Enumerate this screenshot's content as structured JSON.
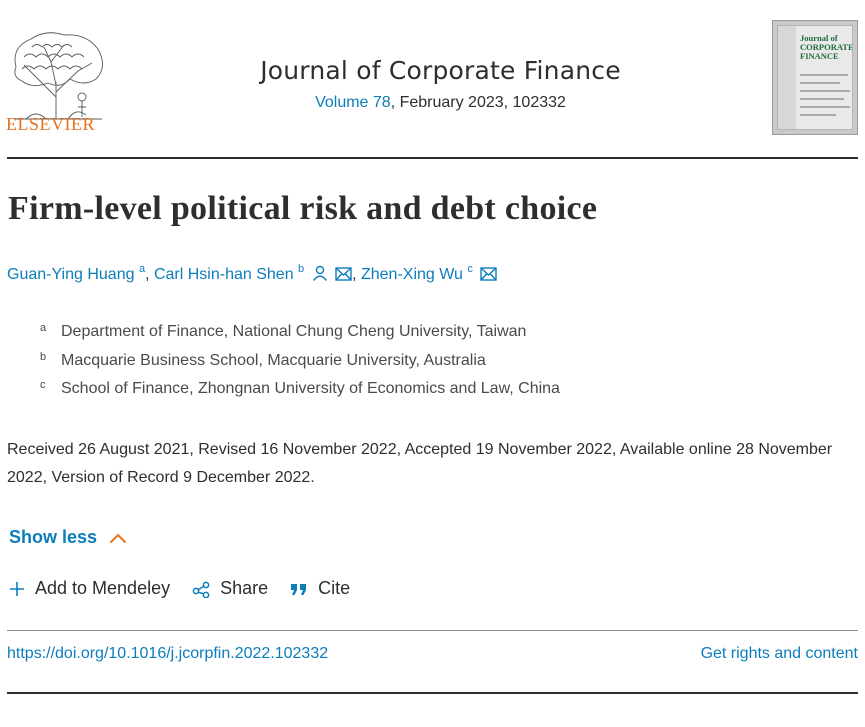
{
  "publisher": {
    "name": "ELSEVIER",
    "brand_color": "#e9711c"
  },
  "journal": {
    "title": "Journal of Corporate Finance",
    "volume_link": "Volume 78",
    "issue_info": ", February 2023, 102332",
    "cover_title": "Journal of CORPORATE FINANCE"
  },
  "article": {
    "title": "Firm-level political risk and debt choice",
    "authors": [
      {
        "name": "Guan-Ying Huang",
        "affil": "a"
      },
      {
        "name": "Carl Hsin-han Shen",
        "affil": "b"
      },
      {
        "name": "Zhen-Xing Wu",
        "affil": "c"
      }
    ],
    "affiliations": [
      {
        "label": "a",
        "text": "Department of Finance, National Chung Cheng University, Taiwan"
      },
      {
        "label": "b",
        "text": "Macquarie Business School, Macquarie University, Australia"
      },
      {
        "label": "c",
        "text": "School of Finance, Zhongnan University of Economics and Law, China"
      }
    ],
    "history": "Received 26 August 2021, Revised 16 November 2022, Accepted 19 November 2022, Available online 28 November 2022, Version of Record 9 December 2022."
  },
  "controls": {
    "show_less": "Show less",
    "add_to_mendeley": "Add to Mendeley",
    "share": "Share",
    "cite": "Cite"
  },
  "links": {
    "doi": "https://doi.org/10.1016/j.jcorpfin.2022.102332",
    "rights": "Get rights and content"
  },
  "colors": {
    "link": "#0c7dbb",
    "text": "#2e2e2e",
    "accent": "#e9711c"
  },
  "icons": [
    "elsevier-tree-logo",
    "journal-cover",
    "person-icon",
    "envelope-icon",
    "chevron-up-icon",
    "plus-icon",
    "share-icon",
    "quote-icon"
  ]
}
